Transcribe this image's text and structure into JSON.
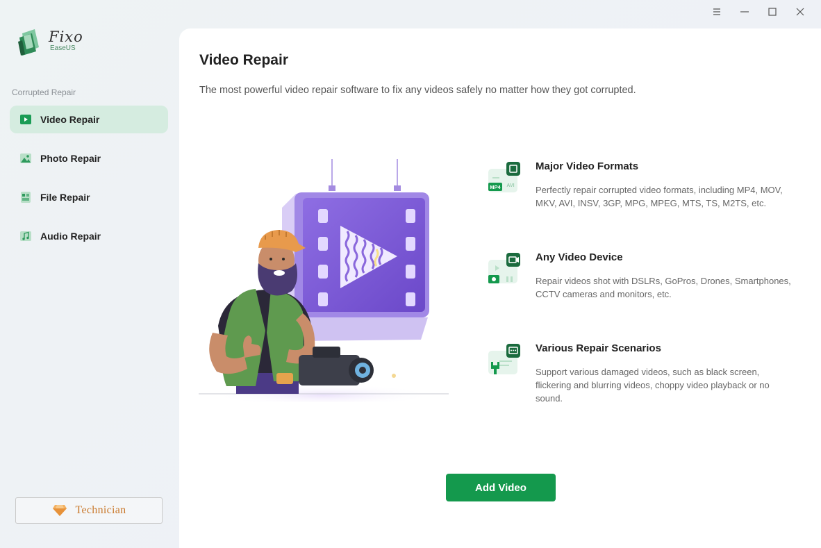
{
  "app": {
    "name": "Fixo",
    "vendor": "EaseUS"
  },
  "window_controls": [
    "menu-icon",
    "minimize-icon",
    "maximize-icon",
    "close-icon"
  ],
  "sidebar": {
    "section_label": "Corrupted Repair",
    "items": [
      {
        "label": "Video Repair",
        "icon": "video-play-icon",
        "active": true
      },
      {
        "label": "Photo Repair",
        "icon": "image-icon",
        "active": false
      },
      {
        "label": "File Repair",
        "icon": "document-icon",
        "active": false
      },
      {
        "label": "Audio Repair",
        "icon": "music-note-icon",
        "active": false
      }
    ],
    "technician_label": "Technician"
  },
  "main": {
    "title": "Video Repair",
    "subtitle": "The most powerful video repair software to fix any videos safely no matter how they got corrupted.",
    "features": [
      {
        "title": "Major Video Formats",
        "description": "Perfectly repair corrupted video formats, including MP4, MOV, MKV, AVI, INSV, 3GP, MPG, MPEG, MTS, TS, M2TS, etc.",
        "icon": "video-formats-icon",
        "badge_primary": "MP4",
        "badge_secondary": "AVI"
      },
      {
        "title": "Any Video Device",
        "description": "Repair videos shot with DSLRs, GoPros, Drones, Smartphones, CCTV cameras and monitors, etc.",
        "icon": "video-device-icon"
      },
      {
        "title": "Various Repair Scenarios",
        "description": "Support various damaged videos, such as black screen, flickering and blurring videos, choppy video playback or no sound.",
        "icon": "repair-scenarios-icon"
      }
    ],
    "add_button_label": "Add Video"
  },
  "colors": {
    "accent": "#14994d",
    "active_nav_bg": "#d5ece0",
    "technician_text": "#c9782a",
    "panel_purple": "#7a5ad6"
  }
}
